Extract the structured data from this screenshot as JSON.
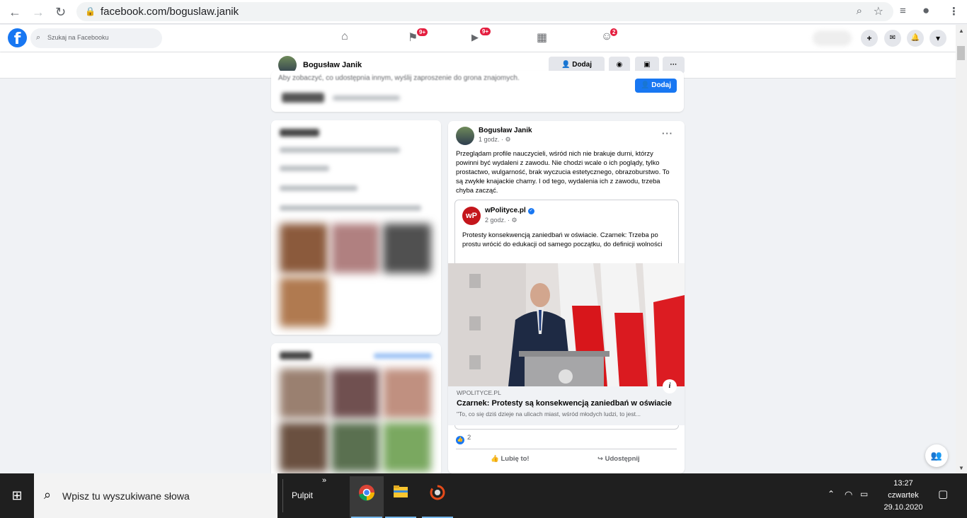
{
  "browser": {
    "url": "facebook.com/boguslaw.janik"
  },
  "fb": {
    "logo": "f",
    "search_placeholder": "Szukaj na Facebooku",
    "nav": [
      {
        "icon": "home-icon",
        "glyph": "⌂",
        "badge": ""
      },
      {
        "icon": "flag-icon",
        "glyph": "⚑",
        "badge": "9+"
      },
      {
        "icon": "watch-icon",
        "glyph": "▶",
        "badge": "9+"
      },
      {
        "icon": "marketplace-icon",
        "glyph": "▦",
        "badge": ""
      },
      {
        "icon": "groups-icon",
        "glyph": "☺",
        "badge": "2"
      }
    ],
    "right_buttons": {
      "plus": "+",
      "messenger": "✉",
      "bell": "🔔",
      "menu": "▾"
    }
  },
  "profile_bar": {
    "name": "Bogusław Janik",
    "add_label": "Dodaj",
    "message_icon": "messenger-icon",
    "more_label": "···"
  },
  "intro": {
    "text": "Aby zobaczyć, co udostępnia innym, wyślij zaproszenie do grona znajomych.",
    "add_label": "Dodaj"
  },
  "post": {
    "author": "Bogusław Janik",
    "time": "1 godz. · ⚙",
    "more": "···",
    "text": "Przeglądam profile nauczycieli, wśród nich nie brakuje durni, którzy powinni być wydaleni z zawodu. Nie chodzi wcale o ich poglądy, tylko prostactwo, wulgarność, brak wyczucia estetycznego, obrazoburstwo. To są zwykłe knajackie chamy. I od tego, wydalenia ich z zawodu, trzeba chyba zacząć.",
    "shared": {
      "logo": "wP",
      "name": "wPolityce.pl",
      "time": "2 godz. · ⚙",
      "text": "Protesty konsekwencją zaniedbań w oświacie. Czarnek: Trzeba po prostu wrócić do edukacji od samego początku, do definicji wolności"
    },
    "link": {
      "domain": "WPOLITYCE.PL",
      "title": "Czarnek: Protesty są konsekwencją zaniedbań w oświacie",
      "desc": "\"To, co się dziś dzieje na ulicach miast, wśród młodych ludzi, to jest..."
    },
    "reactions": "2",
    "like_label": "Lubię to!",
    "share_label": "Udostępnij"
  },
  "taskbar": {
    "search_placeholder": "Wpisz tu wyszukiwane słowa",
    "pulpit": "Pulpit",
    "time": "13:27",
    "day": "czwartek",
    "date": "29.10.2020"
  }
}
